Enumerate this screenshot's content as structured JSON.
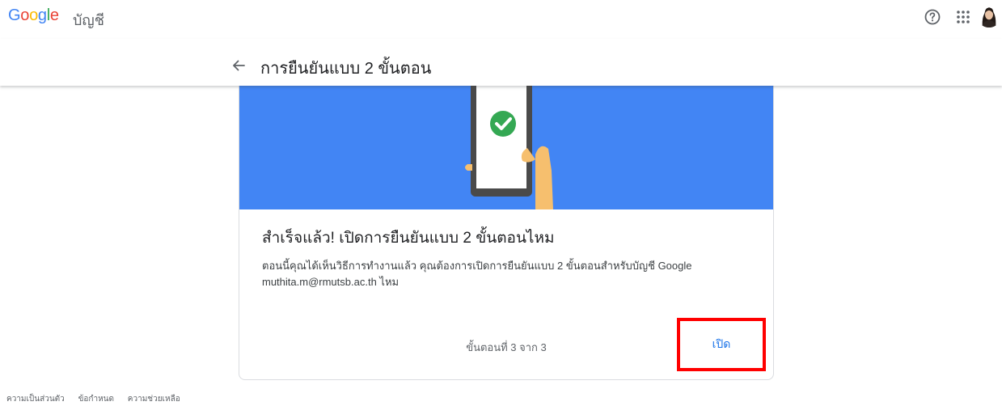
{
  "header": {
    "logo_text": "Google",
    "product_name": "บัญชี",
    "help_icon": "help-circle-icon",
    "apps_icon": "apps-grid-icon",
    "avatar": "user-avatar"
  },
  "page": {
    "back_icon": "arrow-back-icon",
    "title": "การยืนยันแบบ 2 ขั้นตอน"
  },
  "card": {
    "illustration": "phone-checkmark-illustration",
    "title": "สำเร็จแล้ว! เปิดการยืนยันแบบ 2 ขั้นตอนไหม",
    "description": "ตอนนี้คุณได้เห็นวิธีการทำงานแล้ว คุณต้องการเปิดการยืนยันแบบ 2 ขั้นตอนสำหรับบัญชี Google muthita.m@rmutsb.ac.th ไหม",
    "step_text": "ขั้นตอนที่ 3 จาก 3",
    "turn_on_label": "เปิด"
  },
  "footer": {
    "links": [
      "ความเป็นส่วนตัว",
      "ข้อกำหนด",
      "ความช่วยเหลือ"
    ]
  },
  "colors": {
    "hero_blue": "#4285f4",
    "highlight_red": "#ff0000",
    "link_blue": "#1a73e8",
    "check_green": "#34a853"
  }
}
